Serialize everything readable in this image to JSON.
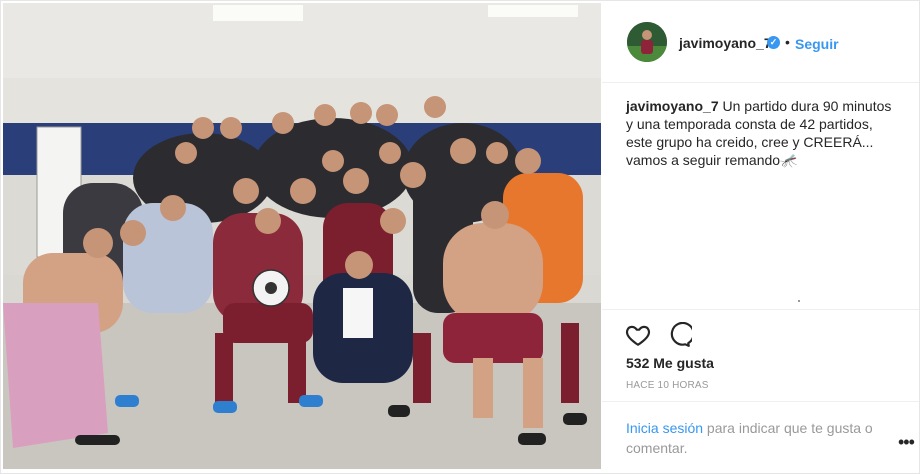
{
  "post": {
    "image_alt": "Foto del equipo celebrando en el vestuario",
    "header": {
      "username": "javimoyano_7",
      "verified_icon": "verified-badge-icon",
      "separator": "•",
      "follow_label": "Seguir"
    },
    "caption": {
      "username": "javimoyano_7",
      "text": "Un partido dura 90 minutos y una temporada consta de 42 partidos, este grupo ha creido, cree y CREERÁ... vamos a seguir remando🦟"
    },
    "actions": {
      "like_icon": "heart-outline-icon",
      "comment_icon": "comment-bubble-icon"
    },
    "likes_label": "532 Me gusta",
    "timestamp": "HACE 10 HORAS",
    "footer": {
      "login_link": "Inicia sesión",
      "login_text": " para indicar que te gusta o comentar.",
      "more_label": "•••"
    }
  },
  "colors": {
    "link_blue": "#3897f0",
    "text": "#262626",
    "muted": "#999999",
    "border": "#efefef"
  }
}
